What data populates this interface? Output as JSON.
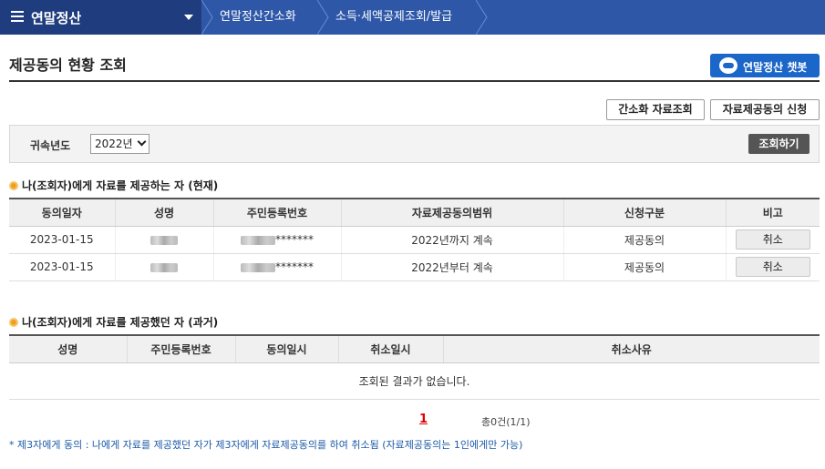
{
  "nav": {
    "home_label": "연말정산",
    "crumbs": [
      "연말정산간소화",
      "소득·세액공제조회/발급"
    ]
  },
  "page": {
    "title": "제공동의 현황 조회",
    "chatbot_label": "연말정산 챗봇"
  },
  "actions": {
    "simplified_query": "간소화 자료조회",
    "consent_apply": "자료제공동의 신청"
  },
  "search": {
    "label": "귀속년도",
    "year_value": "2022년",
    "button": "조회하기"
  },
  "current": {
    "heading": "나(조회자)에게 자료를 제공하는 자 (현재)",
    "headers": [
      "동의일자",
      "성명",
      "주민등록번호",
      "자료제공동의범위",
      "신청구분",
      "비고"
    ],
    "rows": [
      {
        "date": "2023-01-15",
        "rrn_suffix": "*******",
        "scope": "2022년까지 계속",
        "type": "제공동의",
        "action": "취소"
      },
      {
        "date": "2023-01-15",
        "rrn_suffix": "*******",
        "scope": "2022년부터 계속",
        "type": "제공동의",
        "action": "취소"
      }
    ]
  },
  "past": {
    "heading": "나(조회자)에게 자료를 제공했던 자 (과거)",
    "headers": [
      "성명",
      "주민등록번호",
      "동의일시",
      "취소일시",
      "취소사유"
    ],
    "empty_message": "조회된 결과가 없습니다."
  },
  "pager": {
    "current_page": "1",
    "total": "총0건(1/1)"
  },
  "footnote": "* 제3자에게 동의 : 나에게 자료를 제공했던 자가 제3자에게 자료제공동의를 하여 취소됨 (자료제공동의는 1인에게만 가능)",
  "colors": {
    "nav_bg": "#2e57a8",
    "nav_home_bg": "#1f3d7e",
    "chatbot_bg": "#1b66c9",
    "bullet": "#f0a01e"
  }
}
